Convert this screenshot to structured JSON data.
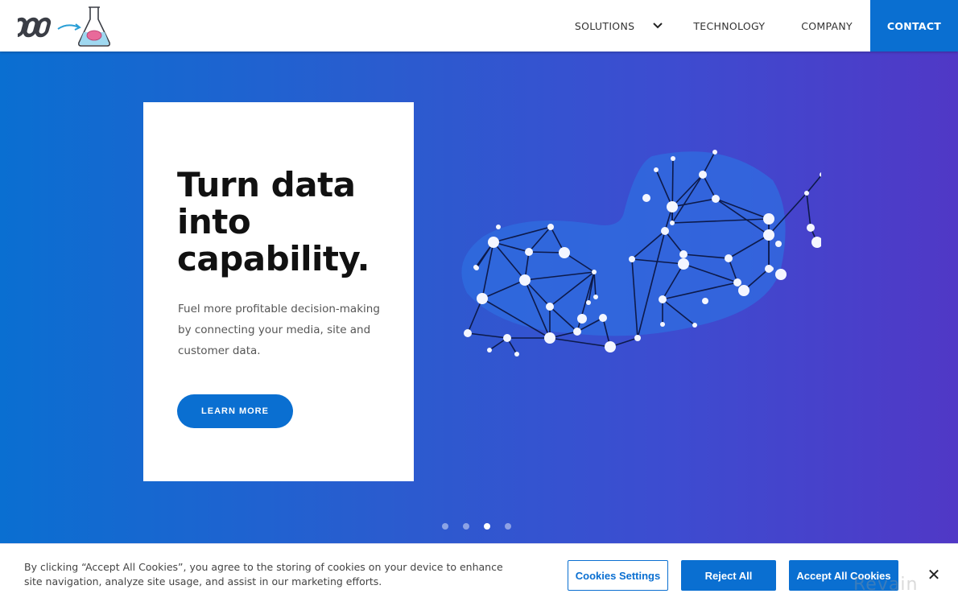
{
  "header": {
    "logo_alt": "ODD to brain flask logo",
    "nav": [
      {
        "label": "SOLUTIONS",
        "has_dropdown": true
      },
      {
        "label": "TECHNOLOGY"
      },
      {
        "label": "COMPANY"
      },
      {
        "label": "CONTACT",
        "highlighted": true
      }
    ]
  },
  "hero": {
    "title": "Turn data into capability.",
    "description": "Fuel more profitable decision-making by connecting your media, site and customer data.",
    "cta_label": "LEARN MORE",
    "carousel": {
      "total": 4,
      "active_index": 2
    }
  },
  "cookie_banner": {
    "text": "By clicking “Accept All Cookies”, you agree to the storing of cookies on your device to enhance site navigation, analyze site usage, and assist in our marketing efforts.",
    "settings_label": "Cookies Settings",
    "reject_label": "Reject All",
    "accept_label": "Accept All Cookies",
    "close_icon": "✕"
  },
  "watermark": "Revain",
  "colors": {
    "brand_blue": "#0a6fd1",
    "gradient_start": "#0a6fd1",
    "gradient_end": "#5038c6"
  }
}
